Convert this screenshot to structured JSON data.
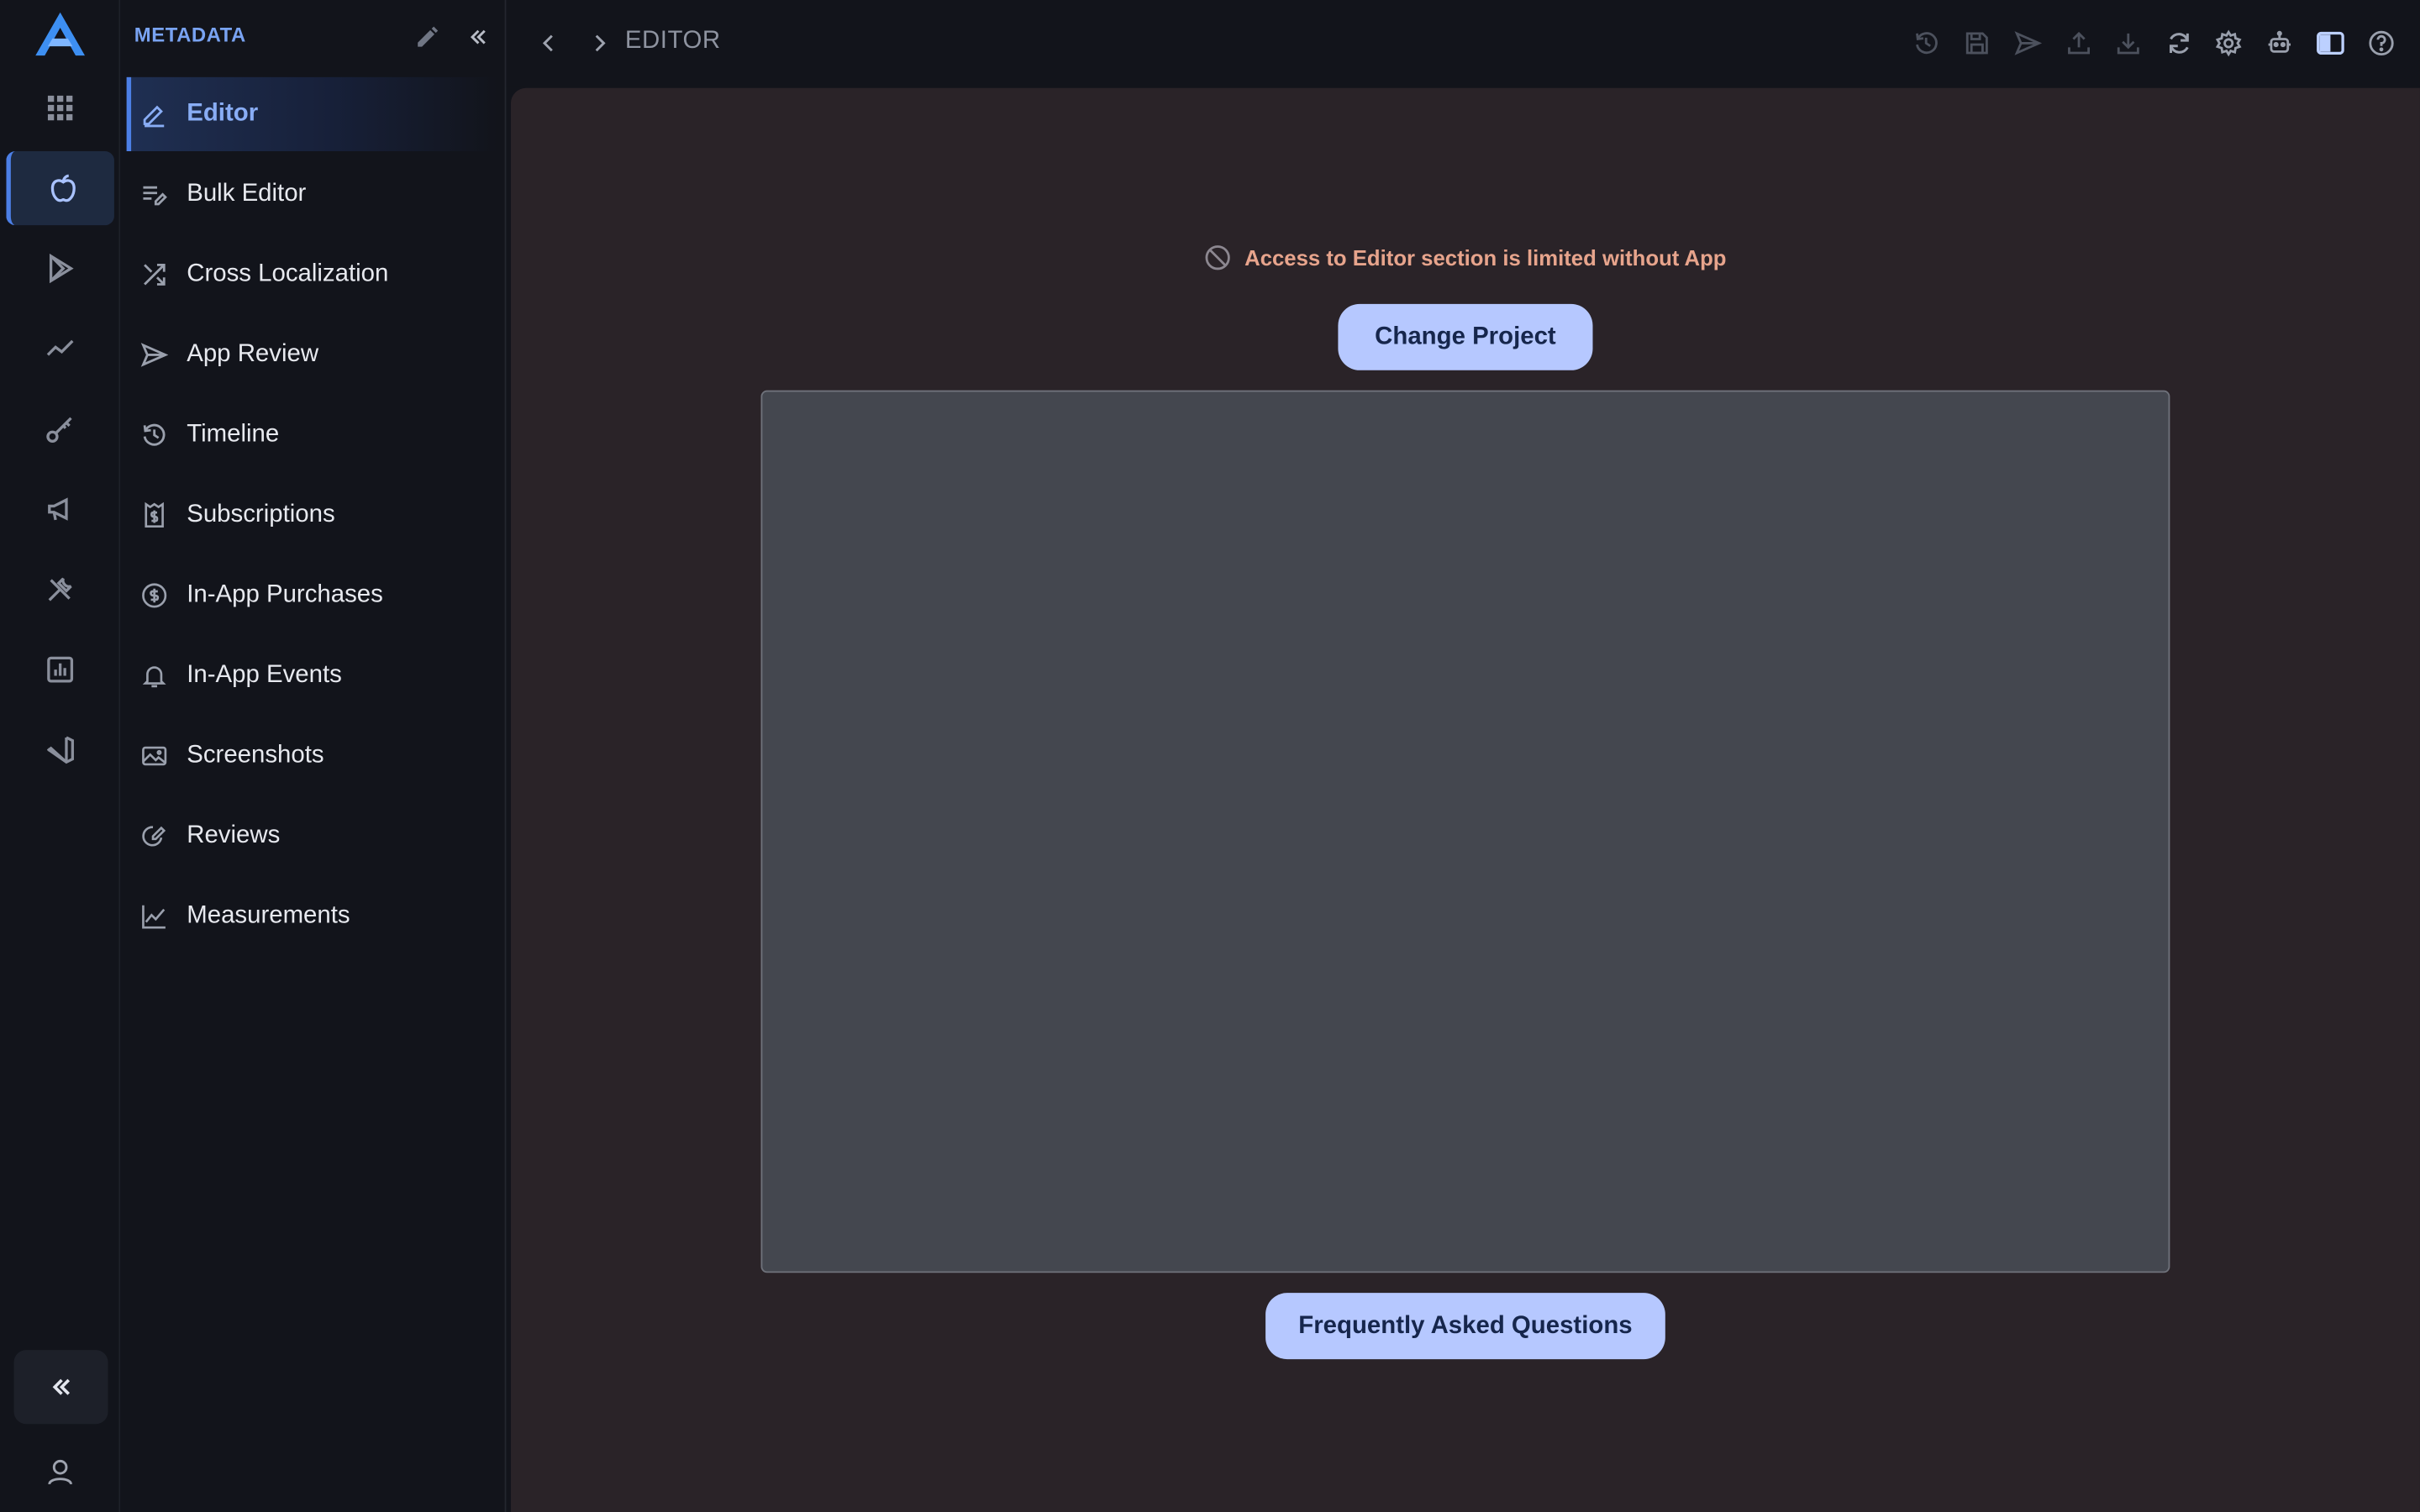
{
  "sidebar": {
    "title": "METADATA",
    "items": [
      {
        "label": "Editor",
        "icon": "pencil-icon"
      },
      {
        "label": "Bulk Editor",
        "icon": "bulk-edit-icon"
      },
      {
        "label": "Cross Localization",
        "icon": "shuffle-icon"
      },
      {
        "label": "App Review",
        "icon": "send-icon"
      },
      {
        "label": "Timeline",
        "icon": "history-icon"
      },
      {
        "label": "Subscriptions",
        "icon": "receipt-dollar-icon"
      },
      {
        "label": "In-App Purchases",
        "icon": "dollar-circle-icon"
      },
      {
        "label": "In-App Events",
        "icon": "bell-icon"
      },
      {
        "label": "Screenshots",
        "icon": "image-icon"
      },
      {
        "label": "Reviews",
        "icon": "review-edit-icon"
      },
      {
        "label": "Measurements",
        "icon": "line-chart-icon"
      }
    ],
    "active_index": 0
  },
  "rail": {
    "icons": [
      "apps-grid-icon",
      "apple-icon",
      "play-store-icon",
      "trend-icon",
      "key-icon",
      "megaphone-icon",
      "tools-icon",
      "bar-chart-icon",
      "vscode-icon"
    ],
    "active": "apple-icon"
  },
  "breadcrumb": {
    "current": "EDITOR"
  },
  "main": {
    "notice": "Access to Editor section is limited without App",
    "change_project": "Change Project",
    "faq": "Frequently Asked Questions"
  },
  "colors": {
    "accent": "#4c7fe6",
    "button_bg": "#b6c8ff",
    "notice_text": "#e7a48c",
    "main_bg": "#2a2328"
  }
}
